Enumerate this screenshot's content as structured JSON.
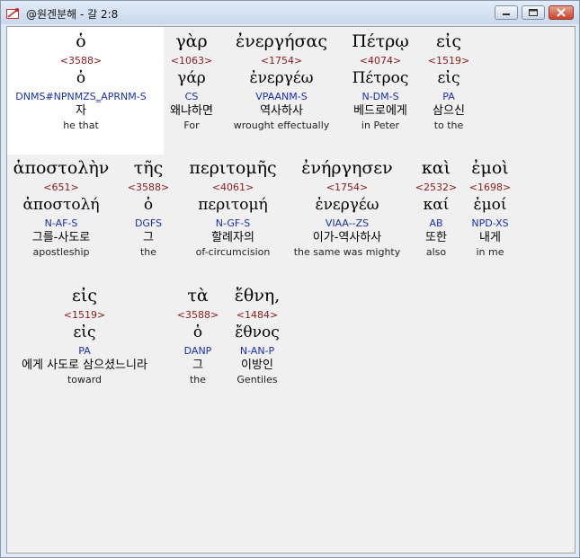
{
  "window": {
    "title": "@원겐분해 - 갈 2:8",
    "buttons": {
      "minimize": "minimize-icon",
      "maximize": "maximize-icon",
      "close": "close-icon"
    }
  },
  "rows": [
    {
      "words": [
        {
          "greek": "ὁ",
          "strong": "<3588>",
          "lemma": "ὁ",
          "morph": "DNMS#NPNMZS‗APRNM-S",
          "korean": "자",
          "english": "he that"
        },
        {
          "greek": "γὰρ",
          "strong": "<1063>",
          "lemma": "γάρ",
          "morph": "CS",
          "korean": "왜냐하면",
          "english": "For"
        },
        {
          "greek": "ἐνεργήσας",
          "strong": "<1754>",
          "lemma": "ἐνεργέω",
          "morph": "VPAANM-S",
          "korean": "역사하사",
          "english": "wrought effectually"
        },
        {
          "greek": "Πέτρῳ",
          "strong": "<4074>",
          "lemma": "Πέτρος",
          "morph": "N-DM-S",
          "korean": "베드로에게",
          "english": "in Peter"
        },
        {
          "greek": "εἰς",
          "strong": "<1519>",
          "lemma": "εἰς",
          "morph": "PA",
          "korean": "삼으신",
          "english": "to the"
        }
      ]
    },
    {
      "words": [
        {
          "greek": "ἀποστολὴν",
          "strong": "<651>",
          "lemma": "ἀποστολή",
          "morph": "N-AF-S",
          "korean": "그를-사도로",
          "english": "apostleship"
        },
        {
          "greek": "τῆς",
          "strong": "<3588>",
          "lemma": "ὁ",
          "morph": "DGFS",
          "korean": "그",
          "english": "the"
        },
        {
          "greek": "περιτομῆς",
          "strong": "<4061>",
          "lemma": "περιτομή",
          "morph": "N-GF-S",
          "korean": "할례자의",
          "english": "of-circumcision"
        },
        {
          "greek": "ἐνήργησεν",
          "strong": "<1754>",
          "lemma": "ἐνεργέω",
          "morph": "VIAA--ZS",
          "korean": "이가-역사하사",
          "english": "the same was mighty"
        },
        {
          "greek": "καὶ",
          "strong": "<2532>",
          "lemma": "καί",
          "morph": "AB",
          "korean": "또한",
          "english": "also"
        },
        {
          "greek": "ἐμοὶ",
          "strong": "<1698>",
          "lemma": "ἐμοί",
          "morph": "NPD-XS",
          "korean": "내게",
          "english": "in me"
        }
      ]
    },
    {
      "words": [
        {
          "greek": "εἰς",
          "strong": "<1519>",
          "lemma": "εἰς",
          "morph": "PA",
          "korean": "에게 사도로 삼으셨느니라",
          "english": "toward"
        },
        {
          "greek": "τὰ",
          "strong": "<3588>",
          "lemma": "ὁ",
          "morph": "DANP",
          "korean": "그",
          "english": "the"
        },
        {
          "greek": "ἔθνη,",
          "strong": "<1484>",
          "lemma": "ἔθνος",
          "morph": "N-AN-P",
          "korean": "이방인",
          "english": "Gentiles"
        }
      ]
    }
  ]
}
